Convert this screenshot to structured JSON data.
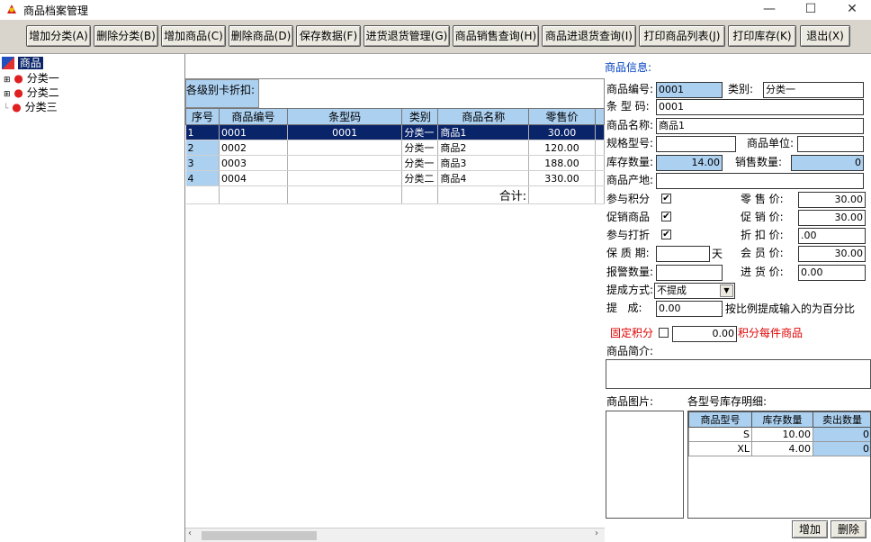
{
  "window": {
    "title": "商品档案管理",
    "minimize": "—",
    "maximize": "☐",
    "close": "✕"
  },
  "toolbar": [
    {
      "label": "增加分类(A)",
      "name": "add-category-button"
    },
    {
      "label": "删除分类(B)",
      "name": "delete-category-button"
    },
    {
      "label": "增加商品(C)",
      "name": "add-product-button"
    },
    {
      "label": "删除商品(D)",
      "name": "delete-product-button"
    },
    {
      "label": "保存数据(F)",
      "name": "save-data-button"
    },
    {
      "label": "进货退货管理(G)",
      "name": "purchase-return-button"
    },
    {
      "label": "商品销售查询(H)",
      "name": "sales-query-button"
    },
    {
      "label": "商品进退货查询(I)",
      "name": "purchase-query-button"
    },
    {
      "label": "打印商品列表(J)",
      "name": "print-list-button"
    },
    {
      "label": "打印库存(K)",
      "name": "print-stock-button"
    },
    {
      "label": "退出(X)",
      "name": "exit-button"
    }
  ],
  "tree": {
    "root": "商品",
    "items": [
      "分类一",
      "分类二",
      "分类三"
    ]
  },
  "discount": {
    "label": "各级别卡折扣:"
  },
  "grid": {
    "headers": [
      "序号",
      "商品编号",
      "条型码",
      "类别",
      "商品名称",
      "零售价"
    ],
    "rows": [
      [
        "1",
        "0001",
        "0001",
        "分类一",
        "商品1",
        "30.00"
      ],
      [
        "2",
        "0002",
        "",
        "分类一",
        "商品2",
        "120.00"
      ],
      [
        "3",
        "0003",
        "",
        "分类一",
        "商品3",
        "188.00"
      ],
      [
        "4",
        "0004",
        "",
        "分类二",
        "商品4",
        "330.00"
      ]
    ],
    "total_label": "合计:"
  },
  "info": {
    "header": "商品信息:",
    "code_label": "商品编号:",
    "code": "0001",
    "category_label": "类别:",
    "category": "分类一",
    "barcode_label": "条 型 码:",
    "barcode": "0001",
    "name_label": "商品名称:",
    "name": "商品1",
    "spec_label": "规格型号:",
    "spec": "",
    "unit_label": "商品单位:",
    "unit": "",
    "stock_label": "库存数量:",
    "stock": "14.00",
    "sold_label": "销售数量:",
    "sold": "0",
    "origin_label": "商品产地:",
    "origin": "",
    "points_label": "参与积分",
    "points_checked": "✔",
    "promo_label": "促销商品",
    "promo_checked": "✔",
    "discount_label": "参与打折",
    "discount_checked": "✔",
    "retail_label": "零 售 价:",
    "retail": "30.00",
    "promo_price_label": "促 销 价:",
    "promo_price": "30.00",
    "discount_price_label": "折 扣 价:",
    "discount_price": ".00",
    "shelf_label": "保 质 期:",
    "shelf": "",
    "shelf_unit": "天",
    "member_label": "会 员 价:",
    "member": "30.00",
    "alarm_label": "报警数量:",
    "alarm": "",
    "purchase_label": "进 货 价:",
    "purchase": "0.00",
    "commission_mode_label": "提成方式:",
    "commission_mode": "不提成",
    "commission_label": "提   成:",
    "commission": "0.00",
    "commission_note": "按比例提成输入的为百分比",
    "fixed_points_label": "固定积分",
    "fixed_points": "0.00",
    "fixed_points_note": "积分每件商品",
    "intro_label": "商品简介:",
    "picture_label": "商品图片:",
    "stock_detail_label": "各型号库存明细:",
    "stock_headers": [
      "商品型号",
      "库存数量",
      "卖出数量"
    ],
    "stock_rows": [
      [
        "S",
        "10.00",
        "0"
      ],
      [
        "XL",
        "4.00",
        "0"
      ]
    ],
    "add_button": "增加",
    "delete_button": "删除"
  },
  "colors": {
    "selection": "#0a246a",
    "accent_blue": "#acd0f0",
    "red_text": "#e00000"
  }
}
